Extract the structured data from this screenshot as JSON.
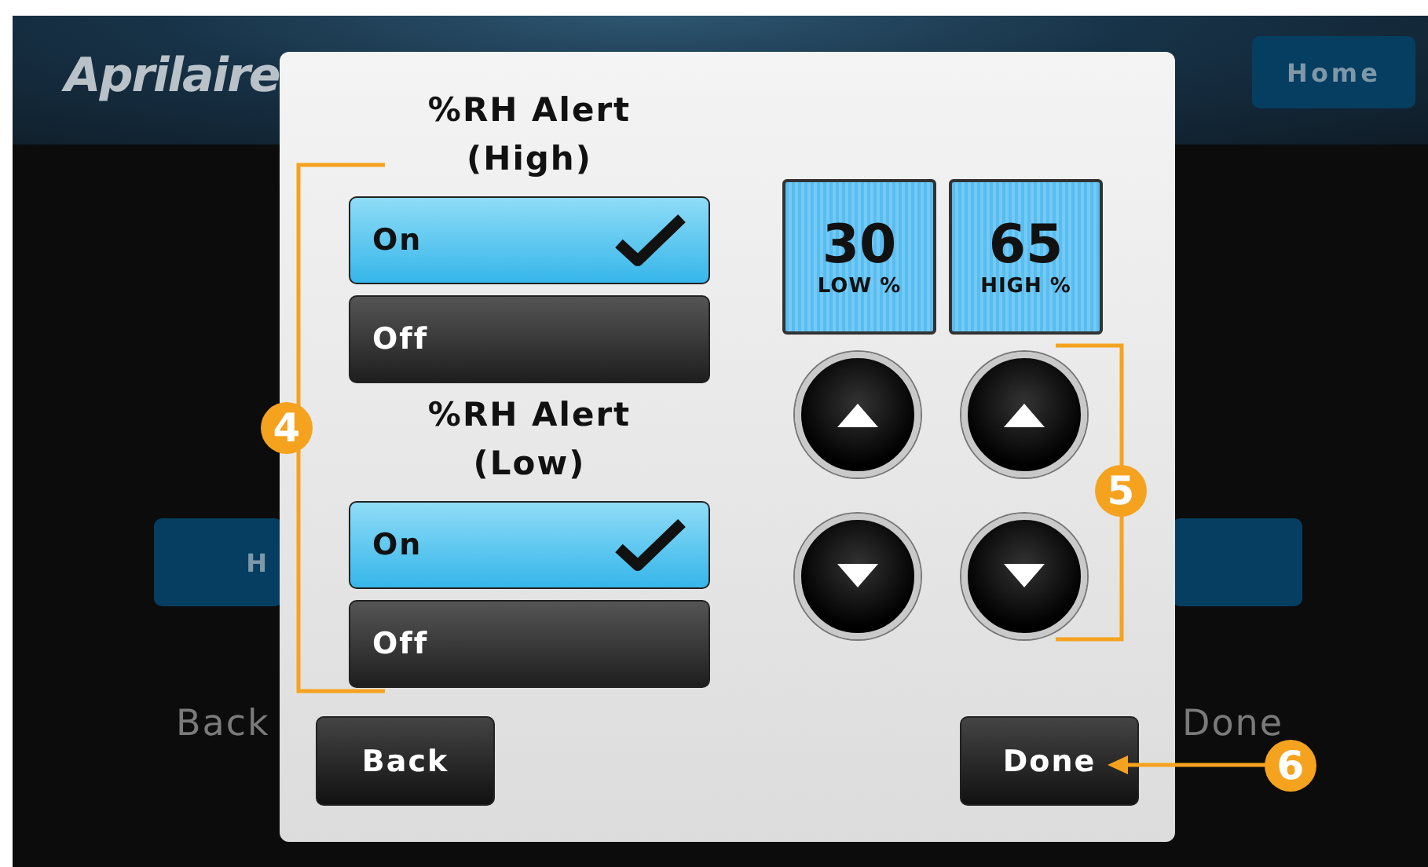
{
  "header": {
    "logo": "Aprilaire",
    "home_button": "Home"
  },
  "background": {
    "left_button": "H",
    "bottom_left": "Back",
    "bottom_right": "Done"
  },
  "dialog": {
    "alerts": [
      {
        "title": "%RH Alert (High)",
        "options": [
          {
            "label": "On",
            "selected": true
          },
          {
            "label": "Off",
            "selected": false
          }
        ]
      },
      {
        "title": "%RH Alert (Low)",
        "options": [
          {
            "label": "On",
            "selected": true
          },
          {
            "label": "Off",
            "selected": false
          }
        ]
      }
    ],
    "readouts": [
      {
        "value": "30",
        "label": "LOW %"
      },
      {
        "value": "65",
        "label": "HIGH %"
      }
    ],
    "steppers": [
      {
        "kind": "up"
      },
      {
        "kind": "up"
      },
      {
        "kind": "down"
      },
      {
        "kind": "down"
      }
    ],
    "buttons": [
      "Back",
      "Done"
    ]
  },
  "callouts": [
    {
      "number": "4"
    },
    {
      "number": "5"
    },
    {
      "number": "6"
    }
  ]
}
